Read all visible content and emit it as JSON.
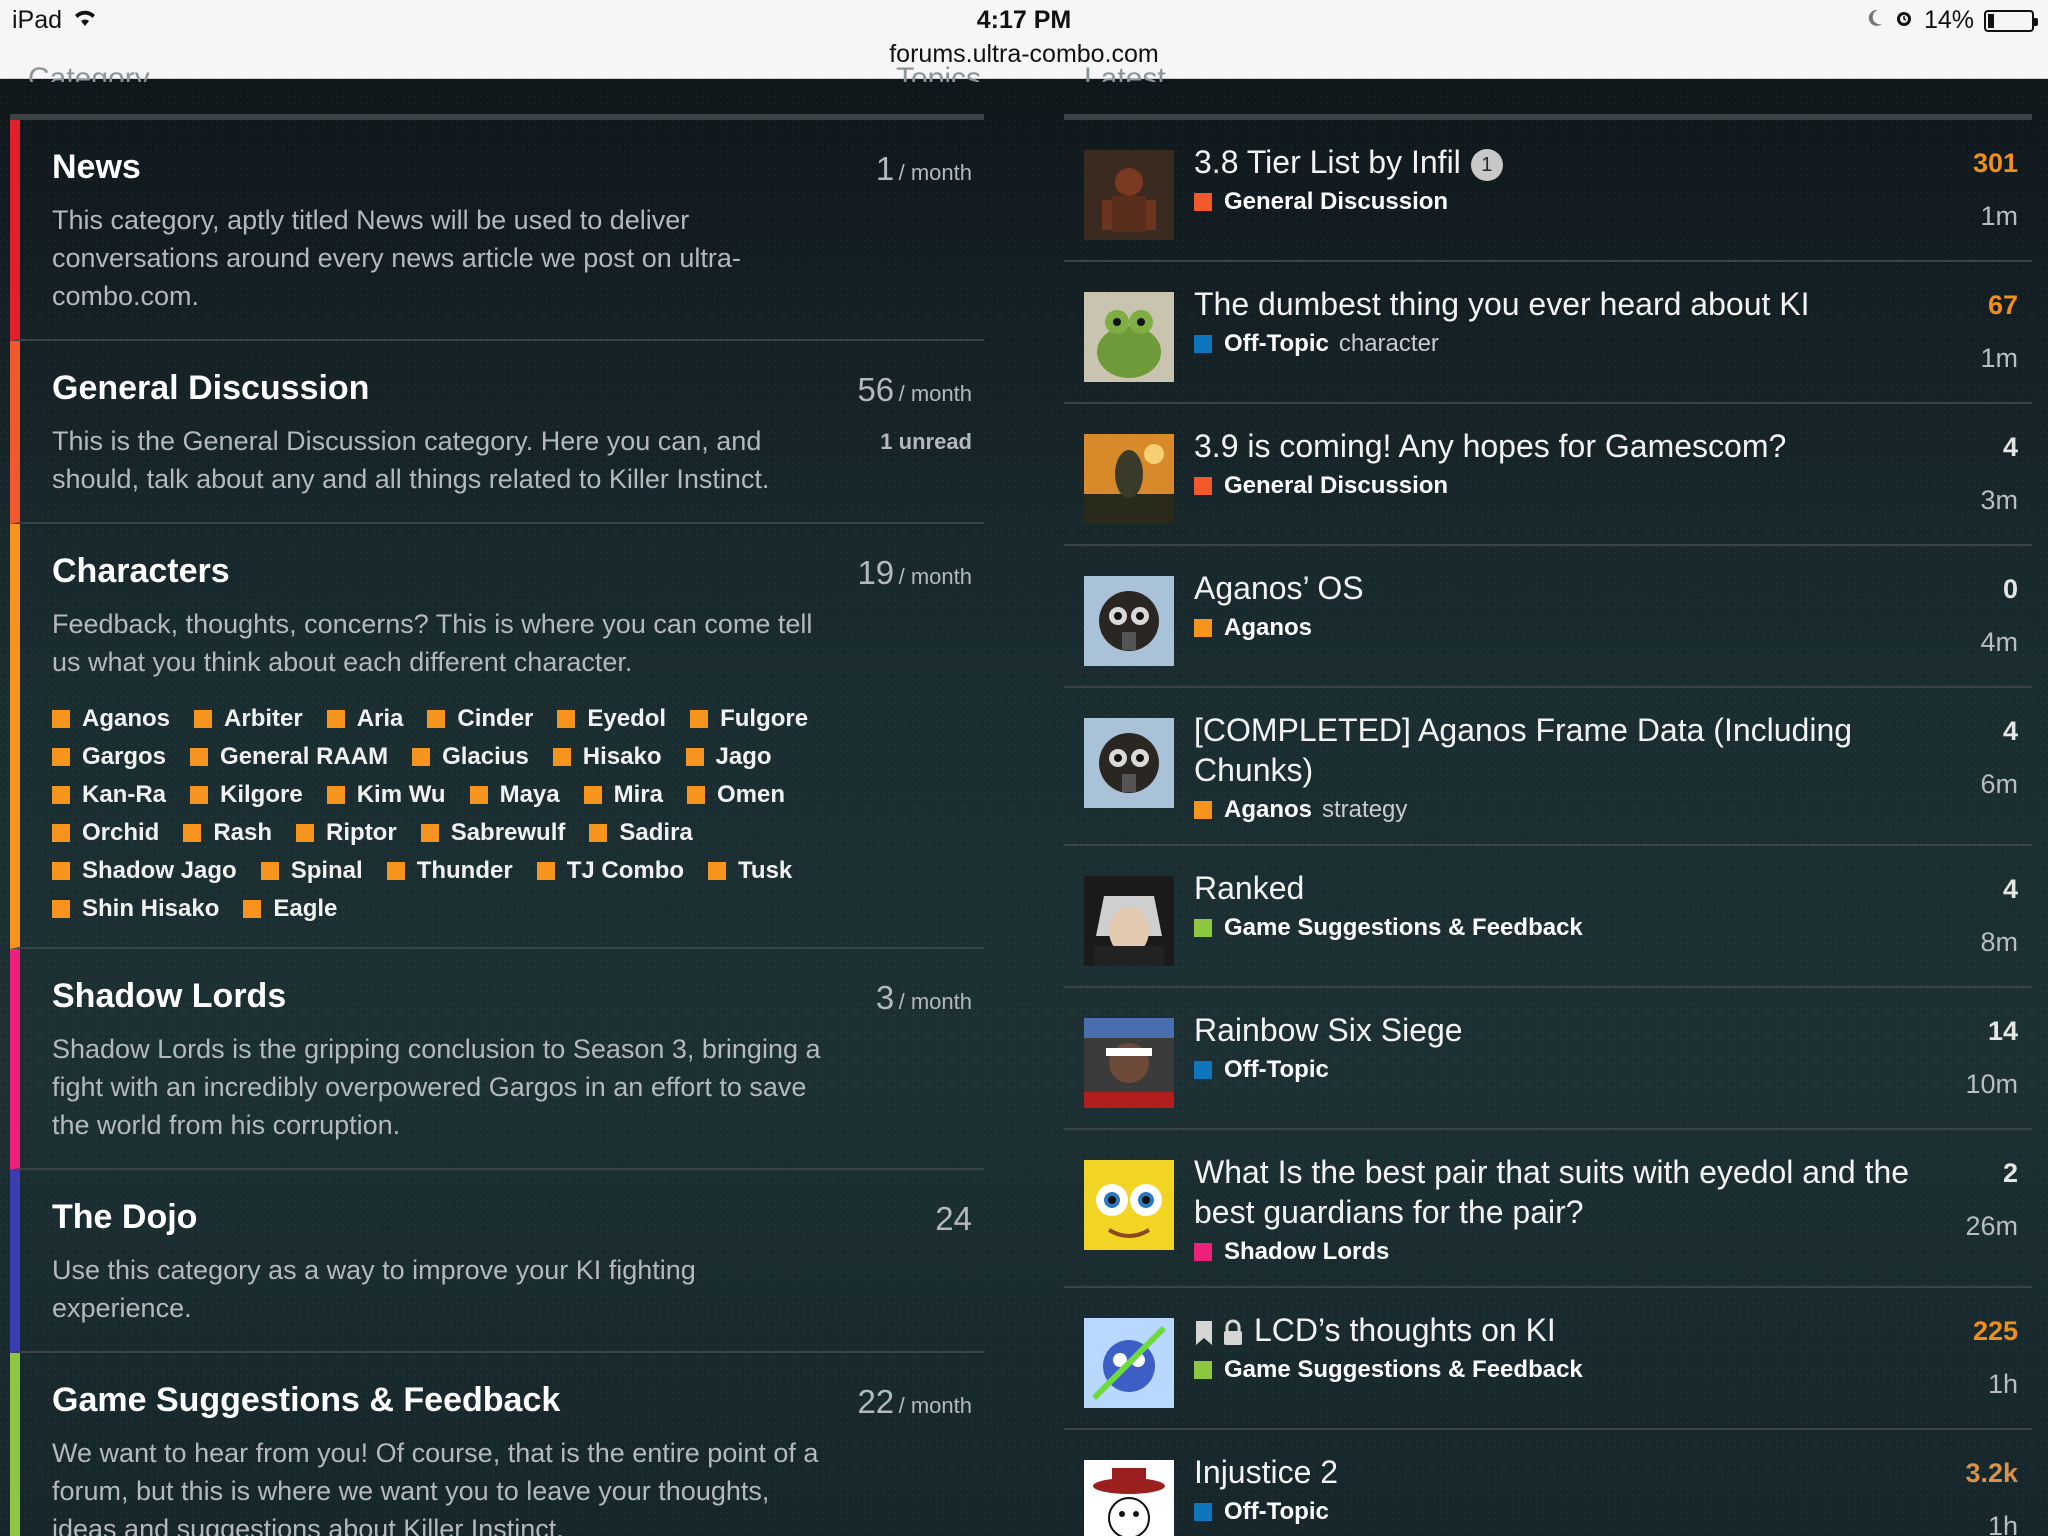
{
  "statusbar": {
    "device": "iPad",
    "time": "4:17 PM",
    "url": "forums.ultra-combo.com",
    "battery": "14%",
    "battery_level": 0.14
  },
  "columns": {
    "category": "Category",
    "topics": "Topics",
    "latest": "Latest"
  },
  "categories": [
    {
      "name": "News",
      "color": "#e31e2d",
      "count": "1",
      "period": "/ month",
      "desc": "This category, aptly titled News will be used to deliver conversations around every news article we post on ultra-combo.com."
    },
    {
      "name": "General Discussion",
      "color": "#f1592a",
      "count": "56",
      "period": "/ month",
      "unread": "1 unread",
      "desc": "This is the General Discussion category. Here you can, and should, talk about any and all things related to Killer Instinct."
    },
    {
      "name": "Characters",
      "color": "#f7941d",
      "count": "19",
      "period": "/ month",
      "desc": "Feedback, thoughts, concerns? This is where you can come tell us what you think about each different character.",
      "subcategories": [
        "Aganos",
        "Arbiter",
        "Aria",
        "Cinder",
        "Eyedol",
        "Fulgore",
        "Gargos",
        "General RAAM",
        "Glacius",
        "Hisako",
        "Jago",
        "Kan-Ra",
        "Kilgore",
        "Kim Wu",
        "Maya",
        "Mira",
        "Omen",
        "Orchid",
        "Rash",
        "Riptor",
        "Sabrewulf",
        "Sadira",
        "Shadow Jago",
        "Spinal",
        "Thunder",
        "TJ Combo",
        "Tusk",
        "Shin Hisako",
        "Eagle"
      ]
    },
    {
      "name": "Shadow Lords",
      "color": "#ed207b",
      "count": "3",
      "period": "/ month",
      "desc": "Shadow Lords is the gripping conclusion to Season 3, bringing a fight with an incredibly overpowered Gargos in an effort to save the world from his corruption."
    },
    {
      "name": "The Dojo",
      "color": "#3b3bb3",
      "count": "24",
      "period": "",
      "desc": "Use this category as a way to improve your KI fighting experience."
    },
    {
      "name": "Game Suggestions & Feedback",
      "color": "#8dc63f",
      "count": "22",
      "period": "/ month",
      "desc": "We want to hear from you! Of course, that is the entire point of a forum, but this is where we want you to leave your thoughts, ideas and suggestions about Killer Instinct."
    }
  ],
  "subcategory_color": "#f7941d",
  "topics": [
    {
      "title": "3.8 Tier List by Infil",
      "badge": "1",
      "category": "General Discussion",
      "cat_color": "#f1592a",
      "tag": "",
      "replies": "301",
      "heat": "hot",
      "activity": "1m",
      "avatar": "warrior-avatar"
    },
    {
      "title": "The dumbest thing you ever heard about KI",
      "category": "Off-Topic",
      "cat_color": "#0e76bd",
      "tag": "character",
      "replies": "67",
      "heat": "hot",
      "activity": "1m",
      "avatar": "frog-avatar"
    },
    {
      "title": "3.9 is coming! Any hopes for Gamescom?",
      "category": "General Discussion",
      "cat_color": "#f1592a",
      "tag": "",
      "replies": "4",
      "heat": "",
      "activity": "3m",
      "avatar": "creature-avatar"
    },
    {
      "title": "Aganos’ OS",
      "category": "Aganos",
      "cat_color": "#f7941d",
      "tag": "",
      "replies": "0",
      "heat": "",
      "activity": "4m",
      "avatar": "gasmask-avatar"
    },
    {
      "title": "[COMPLETED] Aganos Frame Data (Including Chunks)",
      "category": "Aganos",
      "cat_color": "#f7941d",
      "tag": "strategy",
      "replies": "4",
      "heat": "",
      "activity": "6m",
      "avatar": "gasmask-avatar"
    },
    {
      "title": "Ranked",
      "category": "Game Suggestions & Feedback",
      "cat_color": "#8dc63f",
      "tag": "",
      "replies": "4",
      "heat": "",
      "activity": "8m",
      "avatar": "anime-avatar"
    },
    {
      "title": "Rainbow Six Siege",
      "category": "Off-Topic",
      "cat_color": "#0e76bd",
      "tag": "",
      "replies": "14",
      "heat": "",
      "activity": "10m",
      "avatar": "news-avatar"
    },
    {
      "title": "What Is the best pair that suits with eyedol and the best guardians for the pair?",
      "category": "Shadow Lords",
      "cat_color": "#ed207b",
      "tag": "",
      "replies": "2",
      "heat": "",
      "activity": "26m",
      "avatar": "sponge-avatar"
    },
    {
      "title": "LCD’s thoughts on KI",
      "pinned": true,
      "category": "Game Suggestions & Feedback",
      "cat_color": "#8dc63f",
      "tag": "",
      "replies": "225",
      "heat": "hot",
      "activity": "1h",
      "avatar": "cartoon-avatar"
    },
    {
      "title": "Injustice 2",
      "category": "Off-Topic",
      "cat_color": "#0e76bd",
      "tag": "",
      "replies": "3.2k",
      "heat": "warm",
      "activity": "1h",
      "avatar": "hat-avatar"
    }
  ]
}
